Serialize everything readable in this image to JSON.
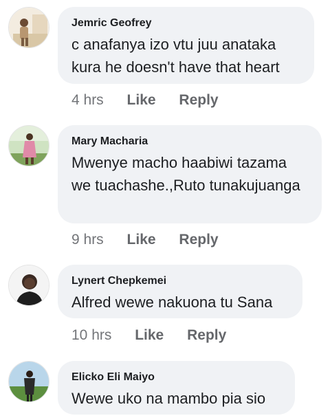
{
  "comments": [
    {
      "author": "Jemric Geofrey",
      "text": "c anafanya izo vtu juu anataka kura he doesn't have that heart",
      "time": "4 hrs",
      "like_label": "Like",
      "reply_label": "Reply"
    },
    {
      "author": "Mary Macharia",
      "text": "Mwenye macho haabiwi tazama we tuachashe.,Ruto tunakujuanga",
      "time": "9 hrs",
      "like_label": "Like",
      "reply_label": "Reply"
    },
    {
      "author": "Lynert Chepkemei",
      "text": "Alfred wewe nakuona tu Sana",
      "time": "10 hrs",
      "like_label": "Like",
      "reply_label": "Reply"
    },
    {
      "author": "Elicko Eli Maiyo",
      "text": "Wewe uko na mambo pia sio"
    }
  ],
  "colors": {
    "bubble_bg": "#f0f2f5",
    "author_text": "#1c1e21",
    "meta_text": "#65676b"
  }
}
